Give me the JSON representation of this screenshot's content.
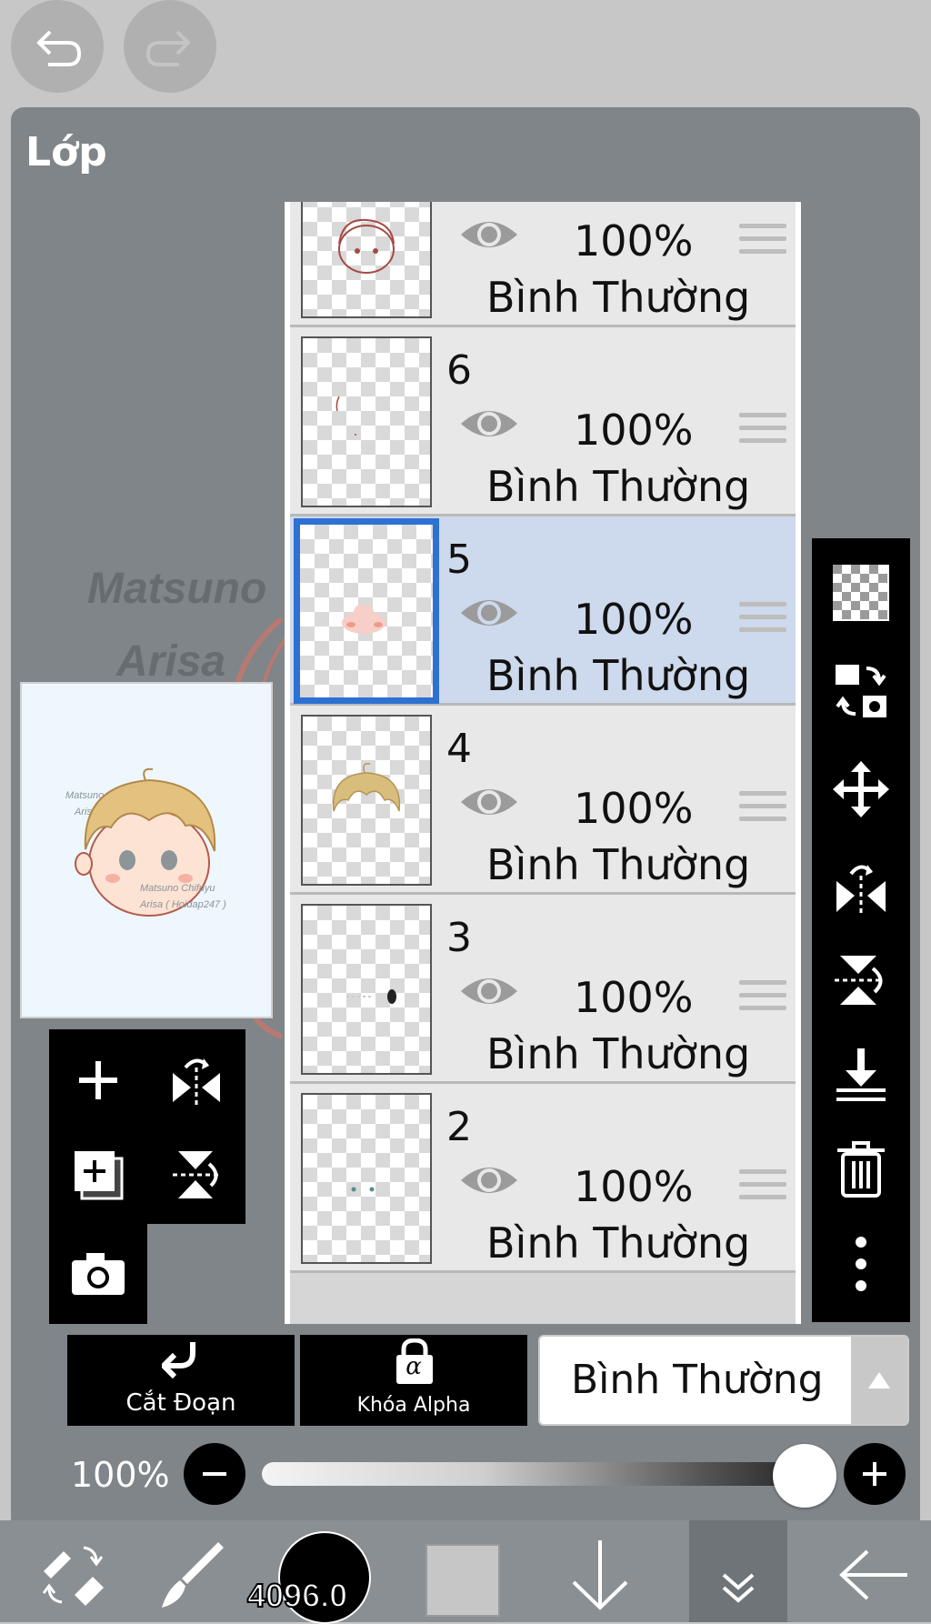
{
  "panel": {
    "title": "Lớp"
  },
  "canvas_watermark": {
    "line1": "Matsuno",
    "line2": "Arisa"
  },
  "preview": {
    "wm_top_1": "Matsuno Chifuyu",
    "wm_top_2": "Arisa ( Hoidap247 )",
    "wm_bottom_1": "Matsuno Chifuyu",
    "wm_bottom_2": "Arisa ( Hoidap247 )"
  },
  "layers": [
    {
      "number": "",
      "opacity": "100%",
      "blend": "Bình Thường",
      "selected": false
    },
    {
      "number": "6",
      "opacity": "100%",
      "blend": "Bình Thường",
      "selected": false
    },
    {
      "number": "5",
      "opacity": "100%",
      "blend": "Bình Thường",
      "selected": true
    },
    {
      "number": "4",
      "opacity": "100%",
      "blend": "Bình Thường",
      "selected": false
    },
    {
      "number": "3",
      "opacity": "100%",
      "blend": "Bình Thường",
      "selected": false
    },
    {
      "number": "2",
      "opacity": "100%",
      "blend": "Bình Thường",
      "selected": false
    }
  ],
  "clipping": {
    "label": "Cắt Đoạn"
  },
  "alpha_lock": {
    "label": "Khóa Alpha",
    "glyph": "α"
  },
  "blend_mode": {
    "value": "Bình Thường"
  },
  "opacity": {
    "label": "100%",
    "value": 100
  },
  "brush": {
    "size": "4096.0"
  },
  "colors": {
    "panel": "#7f8589",
    "selection": "#cdd9ec",
    "selection_border": "#2d71d3"
  }
}
